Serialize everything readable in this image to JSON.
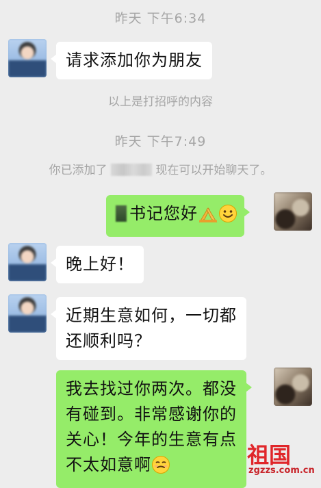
{
  "timestamps": [
    "昨天 下午6:34",
    "昨天 下午7:49"
  ],
  "system": {
    "greeting_note": "以上是打招呼的内容",
    "added_prefix": "你已添加了",
    "added_suffix": "现在可以开始聊天了。"
  },
  "messages": [
    {
      "side": "left",
      "text": "请求添加你为朋友"
    },
    {
      "side": "right",
      "text": "书记您好"
    },
    {
      "side": "left",
      "text": "晚上好！"
    },
    {
      "side": "left",
      "lines": [
        "近期生意如何，一切都",
        "还顺利吗？"
      ]
    },
    {
      "side": "right",
      "lines": [
        "我去找过你两次。都没",
        "有碰到。非常感谢你的",
        "关心！今年的生意有点",
        "不太如意啊"
      ]
    }
  ],
  "watermark": {
    "brand": "祖国",
    "url": "zgzzs.com.cn"
  },
  "colors": {
    "background": "#ededed",
    "bubble_self": "#95ec69",
    "bubble_other": "#ffffff",
    "system_text": "#a5a5a5"
  }
}
